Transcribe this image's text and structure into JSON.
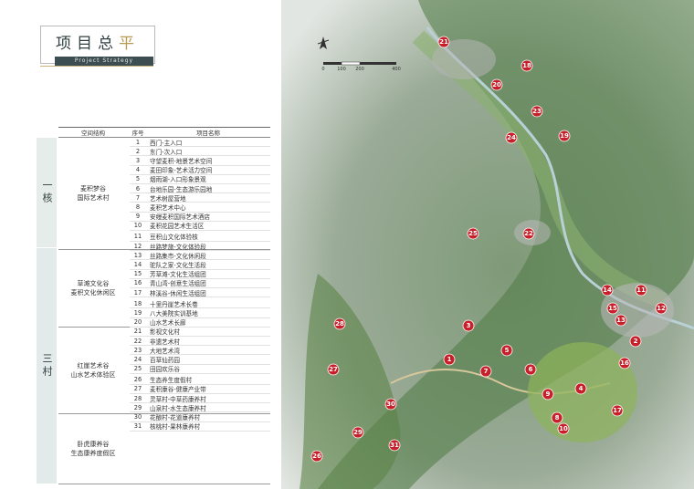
{
  "header": {
    "title_main": "项目总",
    "title_accent": "平",
    "subtitle": "Project Strategy"
  },
  "table": {
    "columns": [
      "空间结构",
      "序号",
      "项目名称"
    ],
    "groups": [
      {
        "label": "一核",
        "zones": [
          {
            "name_l1": "麦积梦谷",
            "name_l2": "国际艺术村",
            "items": [
              {
                "no": "1",
                "name": "西门-主入口"
              },
              {
                "no": "2",
                "name": "东门-次入口"
              },
              {
                "no": "3",
                "name": "守望麦积-地景艺术空间"
              },
              {
                "no": "4",
                "name": "麦田印象-艺术活力空间"
              },
              {
                "no": "5",
                "name": "烟雨湖-入口形象景观"
              },
              {
                "no": "6",
                "name": "台地乐园-生态游乐园地"
              },
              {
                "no": "7",
                "name": "艺术树屋营地"
              },
              {
                "no": "8",
                "name": "麦积艺术中心"
              },
              {
                "no": "9",
                "name": "安缦麦积国际艺术酒店"
              },
              {
                "no": "10",
                "name": "麦积花园艺术生活区"
              }
            ]
          }
        ]
      },
      {
        "label": "三村",
        "zones": [
          {
            "name_l1": "草滩文化谷",
            "name_l2": "麦积文化休闲区",
            "items": [
              {
                "no": "11",
                "name": "豆积山文化体验核"
              },
              {
                "no": "12",
                "name": "丝路梦旅-文化体验段"
              },
              {
                "no": "13",
                "name": "丝路集市-文化休闲段"
              },
              {
                "no": "14",
                "name": "驼队之家-文化生活段"
              },
              {
                "no": "15",
                "name": "芳草滩-文化生活组团"
              },
              {
                "no": "16",
                "name": "青山湾-创意生活组团"
              },
              {
                "no": "17",
                "name": "林溪谷-休闲生活组团"
              }
            ]
          },
          {
            "name_l1": "红崖艺术谷",
            "name_l2": "山水艺术体验区",
            "items": [
              {
                "no": "18",
                "name": "十里丹崖艺术长卷"
              },
              {
                "no": "19",
                "name": "八大美院实训基地"
              },
              {
                "no": "20",
                "name": "山水艺术长廊"
              },
              {
                "no": "21",
                "name": "影视文化村"
              },
              {
                "no": "22",
                "name": "非遗艺术村"
              },
              {
                "no": "23",
                "name": "大地艺术湾"
              },
              {
                "no": "24",
                "name": "百草仙药园"
              },
              {
                "no": "25",
                "name": "田园欢乐谷"
              }
            ]
          },
          {
            "name_l1": "卧虎康养谷",
            "name_l2": "生态康养度假区",
            "items": [
              {
                "no": "26",
                "name": "生态养生度假村"
              },
              {
                "no": "27",
                "name": "麦积康谷-健康产业带"
              },
              {
                "no": "28",
                "name": "灵草村-中草药康养村"
              },
              {
                "no": "29",
                "name": "山泉村-水生态康养村"
              },
              {
                "no": "30",
                "name": "花酿村-花道康养村"
              },
              {
                "no": "31",
                "name": "核桃村-果林康养村"
              }
            ]
          }
        ]
      }
    ]
  },
  "map": {
    "scale_labels": [
      "0",
      "100",
      "200",
      "400"
    ],
    "markers": [
      "1",
      "2",
      "3",
      "4",
      "5",
      "6",
      "7",
      "8",
      "9",
      "10",
      "11",
      "12",
      "13",
      "14",
      "15",
      "16",
      "17",
      "18",
      "19",
      "20",
      "21",
      "22",
      "23",
      "24",
      "25",
      "26",
      "27",
      "28",
      "29",
      "30",
      "31"
    ],
    "marker_color": "#c8202a"
  }
}
